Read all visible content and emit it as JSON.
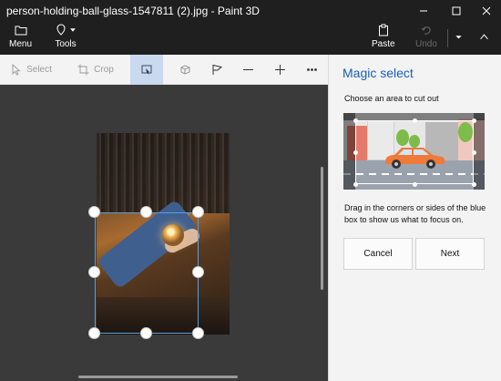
{
  "window": {
    "title": "person-holding-ball-glass-1547811 (2).jpg - Paint 3D",
    "controls": [
      "minimize",
      "maximize",
      "close"
    ]
  },
  "ribbon": {
    "menu_label": "Menu",
    "tools_label": "Tools",
    "paste_label": "Paste",
    "undo_label": "Undo"
  },
  "toolbar": {
    "select_label": "Select",
    "crop_label": "Crop",
    "tools": [
      "magic-select",
      "3d-select",
      "flag",
      "zoom-out",
      "zoom-in",
      "more"
    ]
  },
  "panel": {
    "title": "Magic select",
    "subtitle": "Choose an area to cut out",
    "description": "Drag in the corners or sides of the blue box to show us what to focus on.",
    "cancel_label": "Cancel",
    "next_label": "Next"
  },
  "colors": {
    "accent": "#1a5fb4",
    "selection_border": "#5aa0e0",
    "active_tool": "#c9d9ee",
    "panel_bg": "#f3f3f3",
    "canvas_bg": "#3a3a3a"
  }
}
